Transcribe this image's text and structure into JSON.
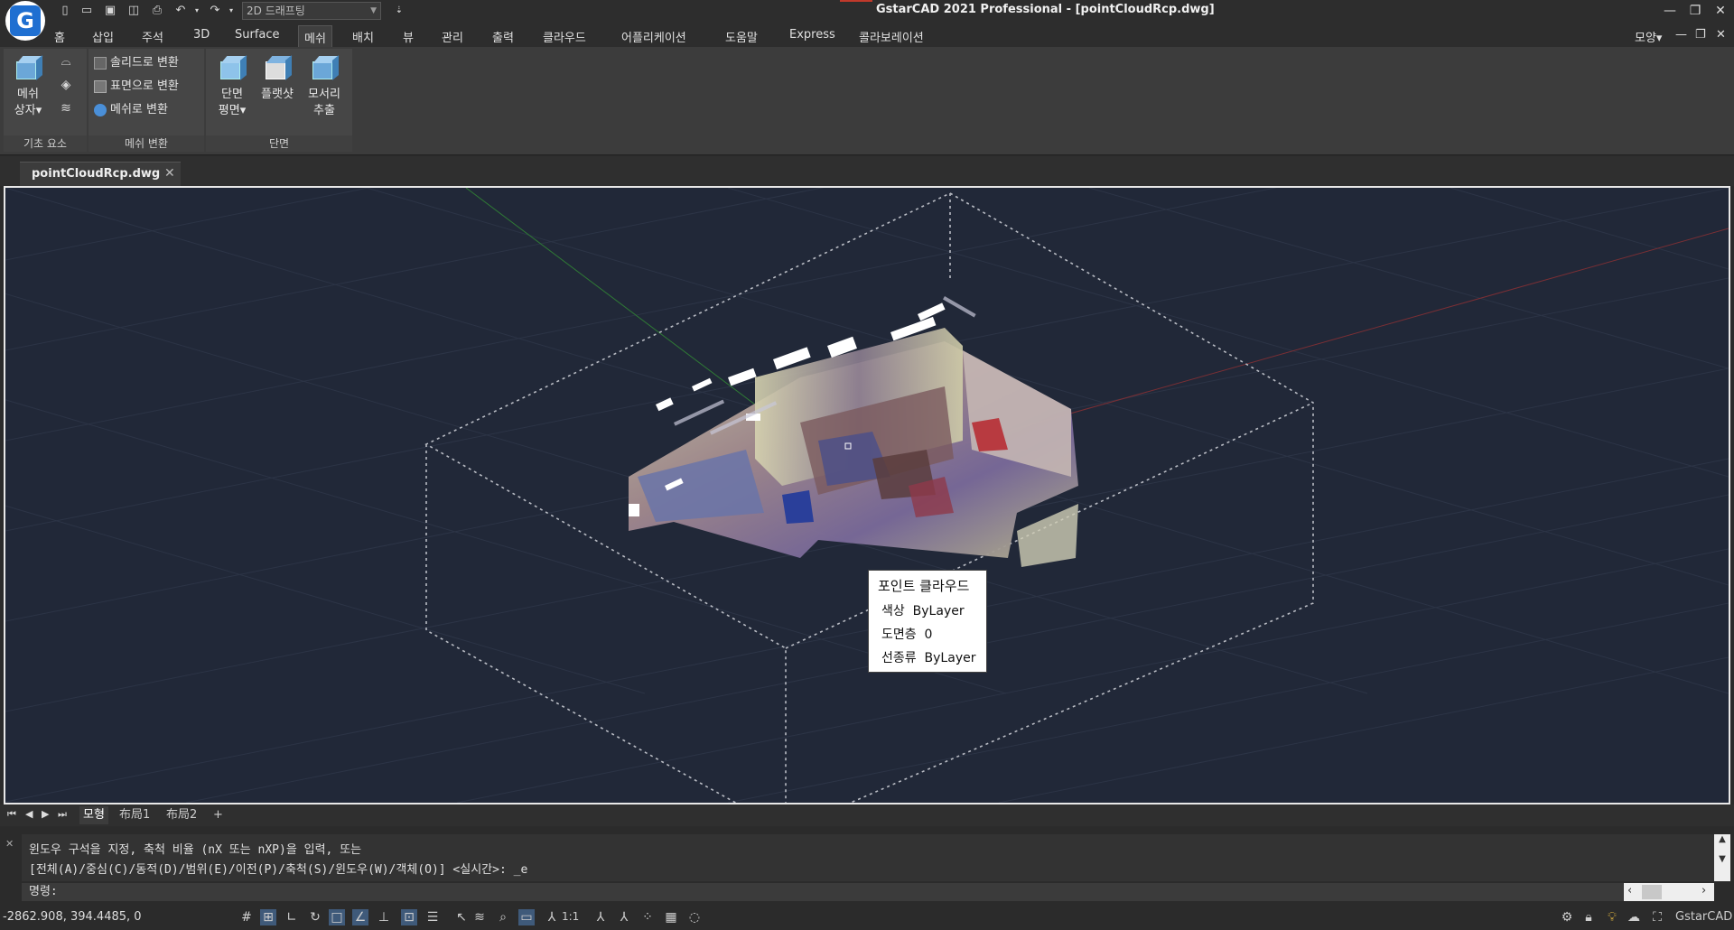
{
  "titlebar": {
    "workspace": "2D 드래프팅",
    "title": "GstarCAD 2021 Professional - [pointCloudRcp.dwg]"
  },
  "menu": {
    "items": [
      "홈",
      "삽입",
      "주석",
      "3D",
      "Surface",
      "메쉬",
      "배치",
      "뷰",
      "관리",
      "출력",
      "클라우드",
      "어플리케이션",
      "도움말",
      "Express",
      "콜라보레이션"
    ],
    "active": "메쉬",
    "right_label": "모양"
  },
  "ribbon": {
    "panel1": {
      "title": "기초 요소",
      "mesh_box_line1": "메쉬",
      "mesh_box_line2": "상자"
    },
    "panel2": {
      "title": "메쉬 변환",
      "to_solid": "솔리드로 변환",
      "to_surface": "표면으로 변환",
      "to_mesh": "메쉬로 변환"
    },
    "panel3": {
      "title": "단면",
      "section_line1": "단면",
      "section_line2": "평면",
      "flatshot": "플랫샷",
      "edge_line1": "모서리",
      "edge_line2": "추출"
    }
  },
  "doc_tab": {
    "label": "pointCloudRcp.dwg"
  },
  "tooltip": {
    "title": "포인트 클라우드",
    "rows": [
      {
        "key": "색상",
        "value": "ByLayer"
      },
      {
        "key": "도면층",
        "value": "0"
      },
      {
        "key": "선종류",
        "value": "ByLayer"
      }
    ]
  },
  "layout_tabs": {
    "model": "모형",
    "layout1": "布局1",
    "layout2": "布局2",
    "add": "+"
  },
  "command": {
    "history1": "윈도우 구석을 지정, 축척 비율 (nX 또는 nXP)을 입력, 또는",
    "history2": "[전체(A)/중심(C)/동적(D)/범위(E)/이전(P)/축척(S)/윈도우(W)/객체(O)] <실시간>: _e",
    "prompt": "명령:"
  },
  "status": {
    "coords": "-2862.908, 394.4485, 0",
    "scale": "1:1",
    "app_name": "GstarCAD"
  }
}
